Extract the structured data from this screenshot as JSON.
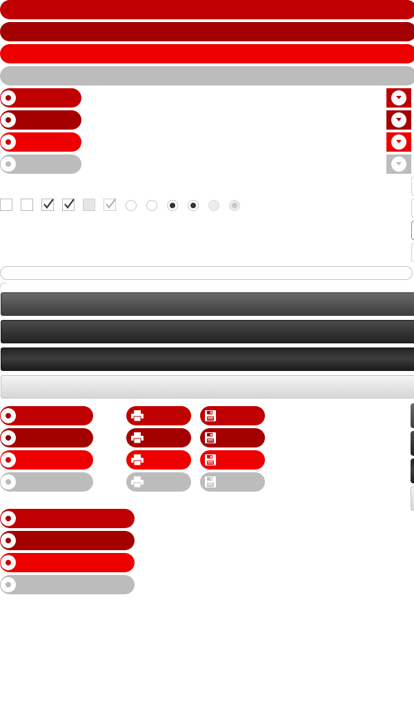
{
  "colors": {
    "red_primary": "#c00000",
    "red_dark": "#a40000",
    "red_bright": "#ee0000",
    "disabled_gray": "#bcbcbc",
    "dark_bar": "#3e3e3e",
    "light_bar": "#e0e0e0"
  },
  "full_bars": [
    "red_primary",
    "red_dark",
    "red_bright",
    "disabled_gray"
  ],
  "radio_buttons": [
    "red_primary",
    "red_dark",
    "red_bright",
    "disabled_gray"
  ],
  "dropdown_buttons": {
    "icon": "chevron-down-icon"
  },
  "form_controls": {
    "checkboxes": [
      "unchecked",
      "unchecked",
      "checked",
      "checked",
      "disabled-unchecked",
      "disabled-checked"
    ],
    "radios": [
      "unselected",
      "unselected",
      "selected",
      "selected",
      "disabled-unselected",
      "disabled-selected"
    ]
  },
  "text_field": {
    "value": "",
    "placeholder": ""
  },
  "gradient_bars": [
    "dark-gray",
    "darker-gray",
    "black-glossy",
    "light-gray"
  ],
  "icon_buttons": {
    "print": {
      "icon": "printer-icon"
    },
    "save": {
      "icon": "floppy-disk-icon"
    }
  }
}
